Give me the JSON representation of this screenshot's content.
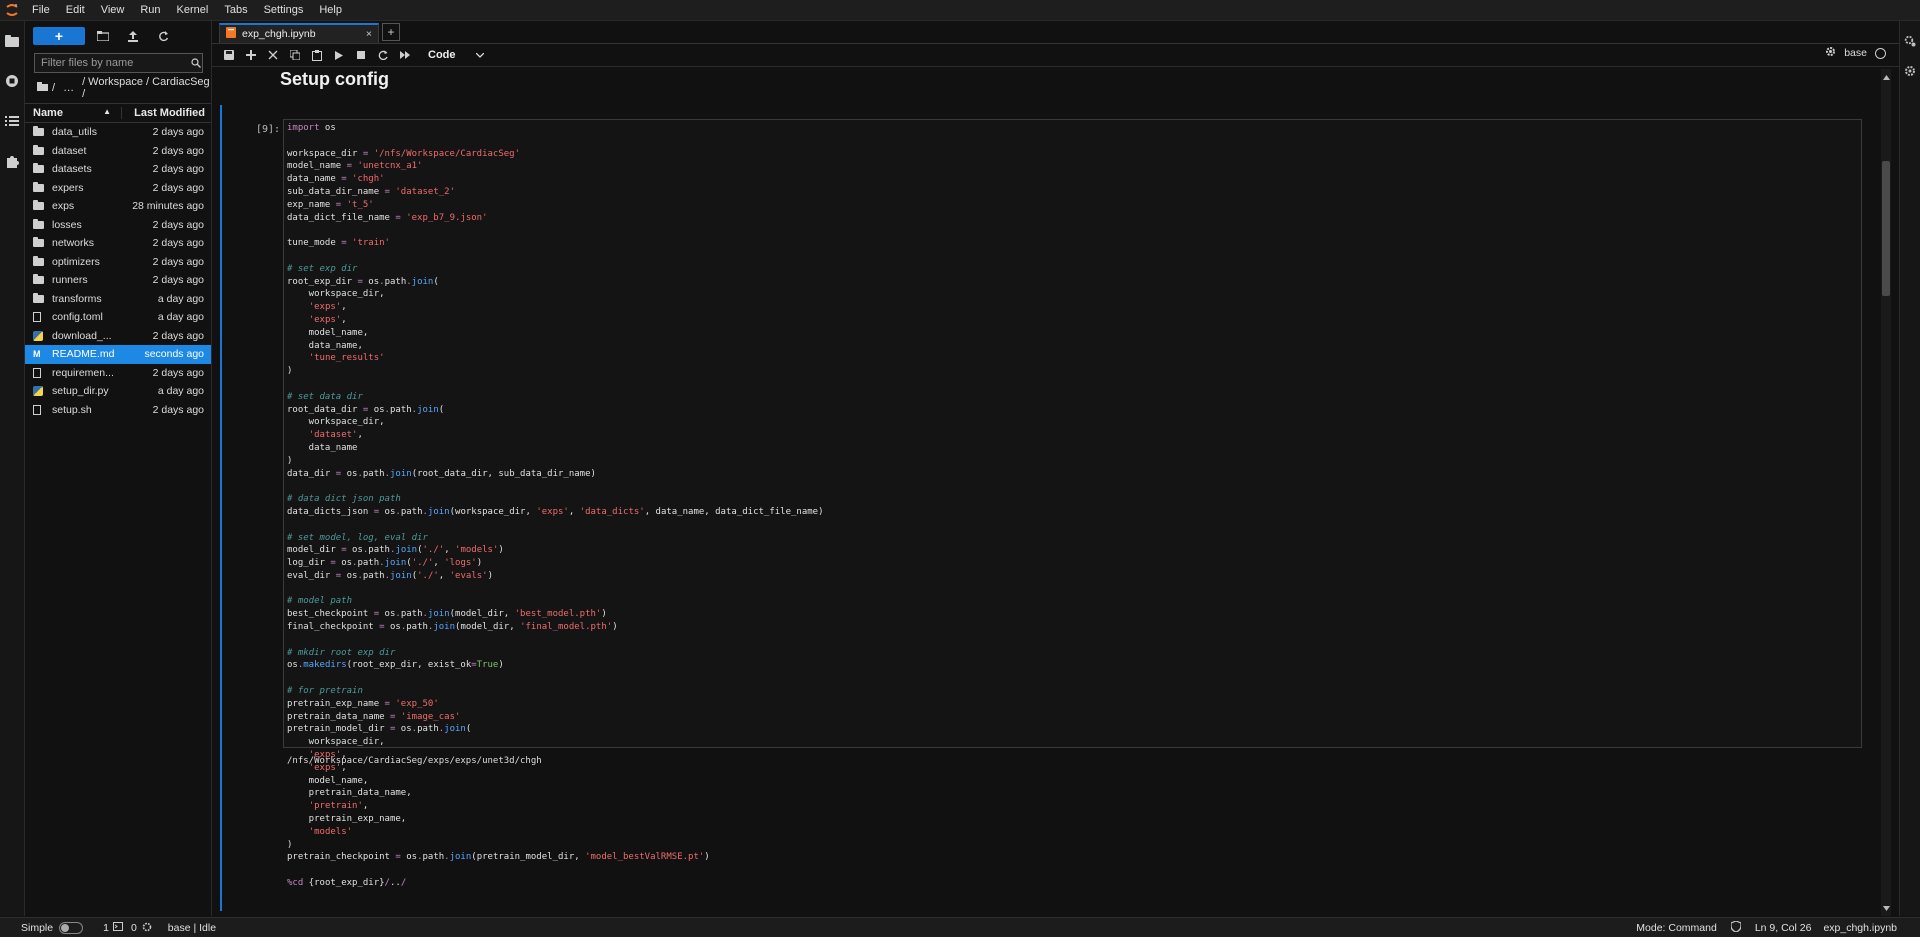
{
  "menu": [
    "File",
    "Edit",
    "View",
    "Run",
    "Kernel",
    "Tabs",
    "Settings",
    "Help"
  ],
  "filebrowser": {
    "new_label": "+",
    "search_placeholder": "Filter files by name",
    "breadcrumb_root": "/",
    "breadcrumb_ellipsis": "…",
    "breadcrumb_path": "/ Workspace / CardiacSeg /",
    "col_name": "Name",
    "col_modified": "Last Modified",
    "files": [
      {
        "name": "data_utils",
        "modified": "2 days ago",
        "type": "folder"
      },
      {
        "name": "dataset",
        "modified": "2 days ago",
        "type": "folder"
      },
      {
        "name": "datasets",
        "modified": "2 days ago",
        "type": "folder"
      },
      {
        "name": "expers",
        "modified": "2 days ago",
        "type": "folder"
      },
      {
        "name": "exps",
        "modified": "28 minutes ago",
        "type": "folder"
      },
      {
        "name": "losses",
        "modified": "2 days ago",
        "type": "folder"
      },
      {
        "name": "networks",
        "modified": "2 days ago",
        "type": "folder"
      },
      {
        "name": "optimizers",
        "modified": "2 days ago",
        "type": "folder"
      },
      {
        "name": "runners",
        "modified": "2 days ago",
        "type": "folder"
      },
      {
        "name": "transforms",
        "modified": "a day ago",
        "type": "folder"
      },
      {
        "name": "config.toml",
        "modified": "a day ago",
        "type": "file"
      },
      {
        "name": "download_...",
        "modified": "2 days ago",
        "type": "python"
      },
      {
        "name": "README.md",
        "modified": "seconds ago",
        "type": "markdown",
        "selected": true
      },
      {
        "name": "requiremen...",
        "modified": "2 days ago",
        "type": "file"
      },
      {
        "name": "setup_dir.py",
        "modified": "a day ago",
        "type": "python"
      },
      {
        "name": "setup.sh",
        "modified": "2 days ago",
        "type": "file"
      }
    ]
  },
  "tab": {
    "title": "exp_chgh.ipynb",
    "close": "×",
    "new": "+"
  },
  "toolbar": {
    "cell_type": "Code",
    "kernel_name": "base"
  },
  "notebook": {
    "markdown_heading": "Setup config",
    "prompt": "[9]:",
    "output": "/nfs/Workspace/CardiacSeg/exps/exps/unet3d/chgh"
  },
  "status": {
    "mode_label": "Simple",
    "n1": "1",
    "n2": "0",
    "kernel_status": "base | Idle",
    "command_mode": "Mode: Command",
    "cursor": "Ln 9, Col 26",
    "filename": "exp_chgh.ipynb"
  },
  "colors": {
    "accent": "#1976d2",
    "selected": "#1e88e5"
  }
}
